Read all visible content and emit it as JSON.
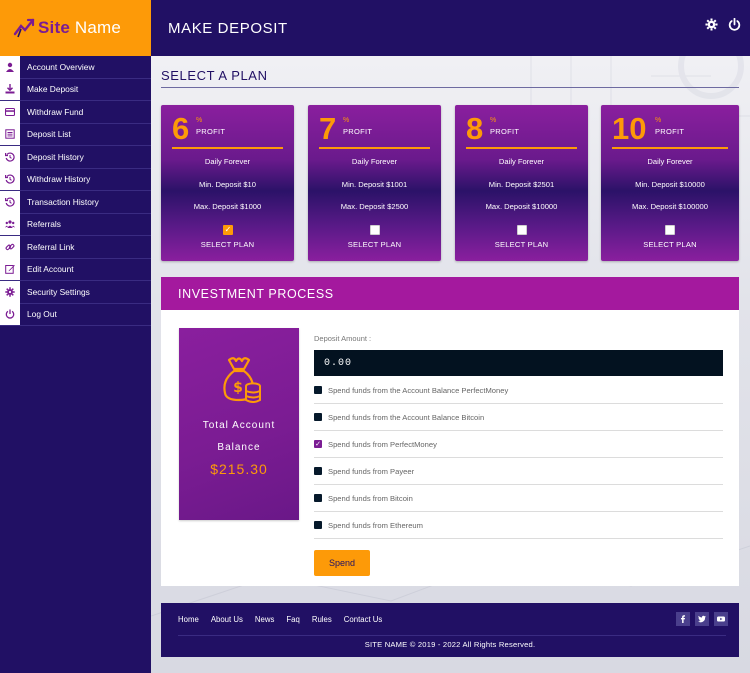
{
  "brand": {
    "site": "Site",
    "name": "Name",
    "accent": "#fd9a08",
    "primary": "#211064",
    "magenta": "#a4199e"
  },
  "topbar": {
    "title": "MAKE DEPOSIT",
    "icons": [
      "gear-icon",
      "power-icon"
    ]
  },
  "sidebar": {
    "items": [
      {
        "label": "Account Overview",
        "icon": "user-icon"
      },
      {
        "label": "Make Deposit",
        "icon": "download-icon"
      },
      {
        "label": "Withdraw Fund",
        "icon": "card-icon"
      },
      {
        "label": "Deposit List",
        "icon": "list-icon"
      },
      {
        "label": "Deposit History",
        "icon": "history-icon"
      },
      {
        "label": "Withdraw History",
        "icon": "history-icon"
      },
      {
        "label": "Transaction History",
        "icon": "history-icon"
      },
      {
        "label": "Referrals",
        "icon": "users-icon"
      },
      {
        "label": "Referral Link",
        "icon": "link-icon"
      },
      {
        "label": "Edit Account",
        "icon": "edit-icon"
      },
      {
        "label": "Security Settings",
        "icon": "gear-icon"
      },
      {
        "label": "Log Out",
        "icon": "power-icon"
      }
    ]
  },
  "select_plan": {
    "title": "SELECT A PLAN",
    "plans": [
      {
        "percent": "6",
        "sign": "%",
        "profit": "PROFIT",
        "term": "Daily Forever",
        "min": "Min. Deposit $10",
        "max": "Max. Deposit $1000",
        "select": "SELECT PLAN",
        "checked": true
      },
      {
        "percent": "7",
        "sign": "%",
        "profit": "PROFIT",
        "term": "Daily Forever",
        "min": "Min. Deposit $1001",
        "max": "Max. Deposit $2500",
        "select": "SELECT PLAN",
        "checked": false
      },
      {
        "percent": "8",
        "sign": "%",
        "profit": "PROFIT",
        "term": "Daily Forever",
        "min": "Min. Deposit $2501",
        "max": "Max. Deposit $10000",
        "select": "SELECT PLAN",
        "checked": false
      },
      {
        "percent": "10",
        "sign": "%",
        "profit": "PROFIT",
        "term": "Daily Forever",
        "min": "Min. Deposit $10000",
        "max": "Max. Deposit $100000",
        "select": "SELECT PLAN",
        "checked": false
      }
    ]
  },
  "investment": {
    "title": "INVESTMENT PROCESS",
    "balance": {
      "line1": "Total Account",
      "line2": "Balance",
      "amount": "$215.30"
    },
    "deposit_label": "Deposit Amount :",
    "deposit_value": "0.00",
    "options": [
      {
        "label": "Spend funds from the Account Balance PerfectMoney",
        "checked": false
      },
      {
        "label": "Spend funds from the Account Balance Bitcoin",
        "checked": false
      },
      {
        "label": "Spend funds from PerfectMoney",
        "checked": true
      },
      {
        "label": "Spend funds from Payeer",
        "checked": false
      },
      {
        "label": "Spend funds from Bitcoin",
        "checked": false
      },
      {
        "label": "Spend funds from Ethereum",
        "checked": false
      }
    ],
    "spend_label": "Spend"
  },
  "footer": {
    "links": [
      "Home",
      "About Us",
      "News",
      "Faq",
      "Rules",
      "Contact Us"
    ],
    "social": [
      "facebook-icon",
      "twitter-icon",
      "youtube-icon"
    ],
    "copyright": "SITE NAME © 2019 - 2022 All Rights Reserved."
  }
}
